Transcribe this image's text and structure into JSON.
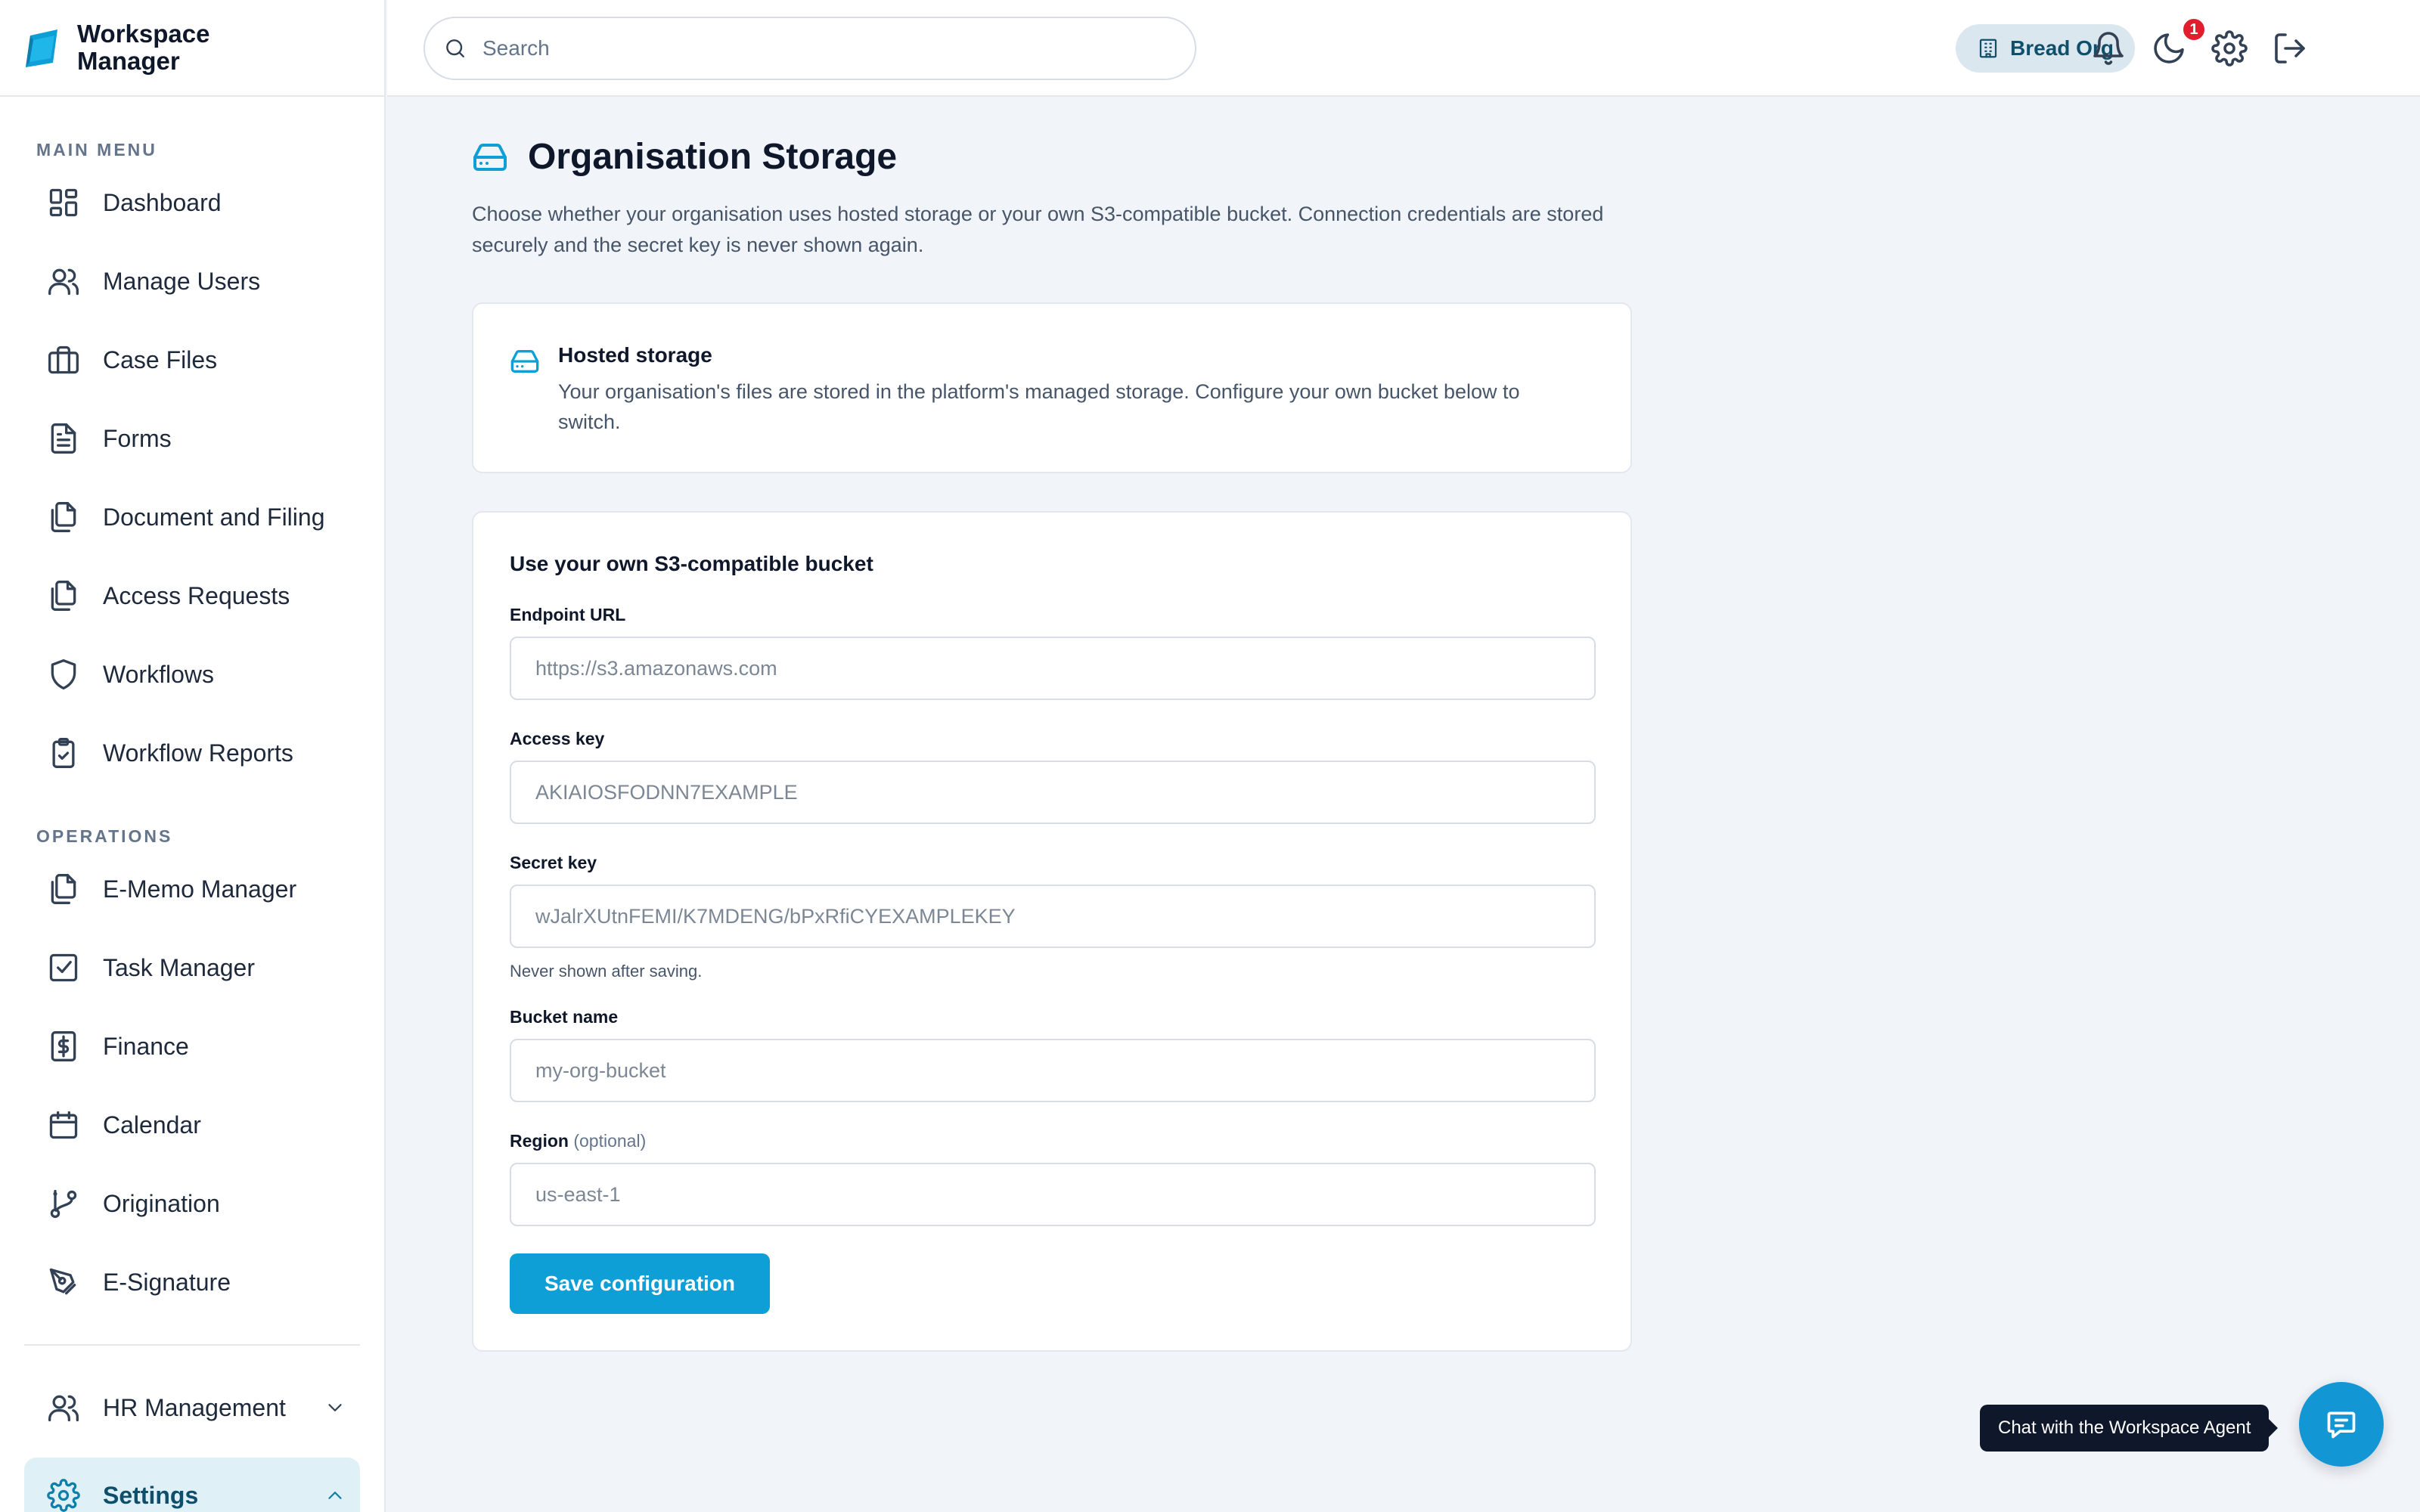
{
  "brand": {
    "line1": "Workspace",
    "line2": "Manager"
  },
  "search": {
    "placeholder": "Search"
  },
  "header": {
    "org_name": "Bread Org",
    "notification_count": "1"
  },
  "sidebar": {
    "main_menu_label": "MAIN MENU",
    "main_items": [
      {
        "label": "Dashboard",
        "icon": "dashboard-icon"
      },
      {
        "label": "Manage Users",
        "icon": "users-icon"
      },
      {
        "label": "Case Files",
        "icon": "briefcase-icon"
      },
      {
        "label": "Forms",
        "icon": "document-icon"
      },
      {
        "label": "Document and Filing",
        "icon": "copy-icon"
      },
      {
        "label": "Access Requests",
        "icon": "copy-icon"
      },
      {
        "label": "Workflows",
        "icon": "shield-icon"
      },
      {
        "label": "Workflow Reports",
        "icon": "clipboard-check-icon"
      }
    ],
    "operations_label": "OPERATIONS",
    "operations_items": [
      {
        "label": "E-Memo Manager",
        "icon": "copy-icon"
      },
      {
        "label": "Task Manager",
        "icon": "checkbox-icon"
      },
      {
        "label": "Finance",
        "icon": "dollar-icon"
      },
      {
        "label": "Calendar",
        "icon": "calendar-icon"
      },
      {
        "label": "Origination",
        "icon": "git-branch-icon"
      },
      {
        "label": "E-Signature",
        "icon": "pen-icon"
      }
    ],
    "hr_management": "HR Management",
    "settings": "Settings"
  },
  "page": {
    "title": "Organisation Storage",
    "description": "Choose whether your organisation uses hosted storage or your own S3-compatible bucket. Connection credentials are stored securely and the secret key is never shown again."
  },
  "hosted_card": {
    "title": "Hosted storage",
    "description": "Your organisation's files are stored in the platform's managed storage. Configure your own bucket below to switch."
  },
  "bucket_form": {
    "title": "Use your own S3-compatible bucket",
    "endpoint": {
      "label": "Endpoint URL",
      "placeholder": "https://s3.amazonaws.com",
      "value": ""
    },
    "access_key": {
      "label": "Access key",
      "placeholder": "AKIAIOSFODNN7EXAMPLE",
      "value": ""
    },
    "secret_key": {
      "label": "Secret key",
      "placeholder": "wJalrXUtnFEMI/K7MDENG/bPxRfiCYEXAMPLEKEY",
      "value": "",
      "hint": "Never shown after saving."
    },
    "bucket_name": {
      "label": "Bucket name",
      "placeholder": "my-org-bucket",
      "value": ""
    },
    "region": {
      "label": "Region",
      "optional_label": "(optional)",
      "placeholder": "us-east-1",
      "value": ""
    },
    "save_label": "Save configuration"
  },
  "chat": {
    "tooltip": "Chat with the Workspace Agent"
  },
  "colors": {
    "accent": "#0e9fd6",
    "active_bg": "#dff0f7",
    "badge": "#e11d2e"
  }
}
